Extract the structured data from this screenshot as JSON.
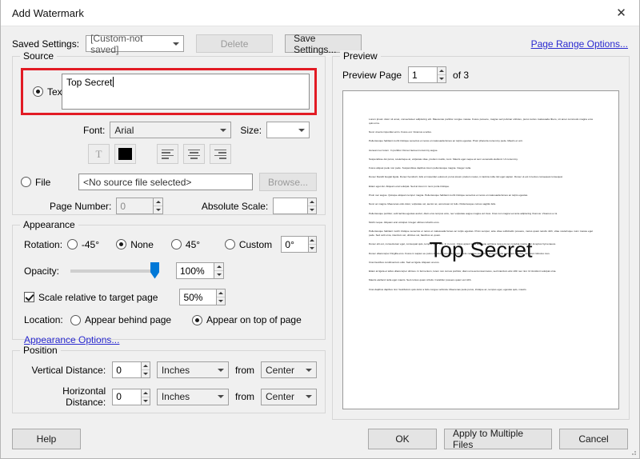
{
  "window": {
    "title": "Add Watermark",
    "close_icon": "close-icon"
  },
  "saved_settings": {
    "label": "Saved Settings:",
    "value": "[Custom-not saved]",
    "delete_label": "Delete",
    "save_label": "Save Settings...",
    "page_range_link": "Page Range Options..."
  },
  "source": {
    "legend": "Source",
    "text_radio_label": "Text",
    "text_value": "Top Secret",
    "font_label": "Font:",
    "font_value": "Arial",
    "size_label": "Size:",
    "size_value": "",
    "tools": [
      {
        "name": "text-properties-icon",
        "glyph": "T"
      },
      {
        "name": "text-color-swatch",
        "color": "#000000"
      },
      {
        "name": "align-left-icon"
      },
      {
        "name": "align-center-icon"
      },
      {
        "name": "align-right-icon"
      }
    ],
    "file_radio_label": "File",
    "file_value": "<No source file selected>",
    "browse_label": "Browse...",
    "page_number_label": "Page Number:",
    "page_number_value": "0",
    "absolute_scale_label": "Absolute Scale:",
    "absolute_scale_value": ""
  },
  "appearance": {
    "legend": "Appearance",
    "rotation_label": "Rotation:",
    "rotation_options": [
      "-45°",
      "None",
      "45°",
      "Custom"
    ],
    "rotation_selected": "None",
    "rotation_custom_value": "0°",
    "opacity_label": "Opacity:",
    "opacity_value": "100%",
    "opacity_percent": 100,
    "scale_checkbox_label": "Scale relative to target page",
    "scale_checked": true,
    "scale_value": "50%",
    "location_label": "Location:",
    "location_options": [
      "Appear behind page",
      "Appear on top of page"
    ],
    "location_selected": "Appear on top of page",
    "appearance_options_link": "Appearance Options..."
  },
  "position": {
    "legend": "Position",
    "rows": [
      {
        "label": "Vertical Distance:",
        "value": "0",
        "unit": "Inches",
        "from_label": "from",
        "origin": "Center"
      },
      {
        "label": "Horizontal Distance:",
        "value": "0",
        "unit": "Inches",
        "from_label": "from",
        "origin": "Center"
      }
    ]
  },
  "preview": {
    "legend": "Preview",
    "page_label": "Preview Page",
    "page_value": "1",
    "of_label": "of 3",
    "watermark_text": "Top Secret",
    "document_paragraphs": [
      "Lorem ipsum dolor sit amet, consectetuer adipiscing elit. Maecenas porttitor congue massa. Fusce posuere, magna sed pulvinar ultricies, purus lectus malesuada libero, sit amet commodo magna eros quis urna.",
      "Nunc viverra imperdiet enim. Fusce est. Vivamus a tellus.",
      "Pellentesque habitant morbi tristique senectus et netus et malesuada fames ac turpis egestas. Proin pharetra nonummy pede. Mauris et orci.",
      "Aenean nec lorem. In porttitor. Donec laoreet nonummy augue.",
      "Suspendisse dui purus, scelerisque at, vulputate vitae, pretium mattis, nunc. Mauris eget neque at sem venenatis eleifend. Ut nonummy.",
      "Fusce aliquet pede non pede. Suspendisse dapibus lorem pellentesque magna. Integer nulla.",
      "Donec blandit feugiat ligula. Donec hendrerit, felis et imperdiet euismod, purus ipsum pretium metus, in lacinia nulla nisl eget sapien. Donec ut est in lectus consequat consequat.",
      "Etiam eget dui. Aliquam erat volutpat. Sed at lorem in nunc porta tristique.",
      "Proin nec augue. Quisque aliquam tempor magna. Pellentesque habitant morbi tristique senectus et netus et malesuada fames ac turpis egestas.",
      "Nunc ac magna. Maecenas odio dolor, vulputate vel, auctor ac, accumsan id, felis. Pellentesque cursus sagittis felis.",
      "Pellentesque porttitor, velit lacinia egestas auctor, diam eros tempus arcu, nec vulputate augue magna vel risus. Cras non magna vel ante adipiscing rhoncus. Vivamus a mi.",
      "Morbi neque. Aliquam erat volutpat. Integer ultrices lobortis eros.",
      "Pellentesque habitant morbi tristique senectus et netus et malesuada fames ac turpis egestas. Proin semper, ante vitae sollicitudin posuere, metus quam iaculis nibh, vitae scelerisque nunc massa eget pede. Sed velit urna, interdum vel, ultricies vel, faucibus at, quam.",
      "Donec elit est, consectetuer eget, consequat quis, tempus quis, wisi. In in nunc. Class aptent taciti sociosqu ad litora torquent per conubia nostra, per inceptos hymenaeos.",
      "Donec ullamcorper fringilla eros. Fusce in sapien eu purus dapibus commodo. Cum sociis natoque penatibus et magnis dis parturient montes, nascetur ridiculus mus.",
      "Cras faucibus condimentum odio. Sed ac ligula. Aliquam at eros.",
      "Etiam at ligula et tellus ullamcorper ultrices. In fermentum, lorem non cursus porttitor, diam urna accumsan lacus, sed interdum wisi nibh nec nisl. Ut tincidunt volutpat urna.",
      "Mauris eleifend nulla eget mauris. Sed cursus quam id felis. Curabitur posuere quam vel nibh.",
      "Cras dapibus dapibus nisl. Vestibulum quis dolor a felis congue vehicula. Maecenas pede purus, tristique ac, tempus eget, egestas quis, mauris."
    ]
  },
  "footer": {
    "help_label": "Help",
    "ok_label": "OK",
    "apply_multiple_label": "Apply to Multiple Files",
    "cancel_label": "Cancel"
  }
}
